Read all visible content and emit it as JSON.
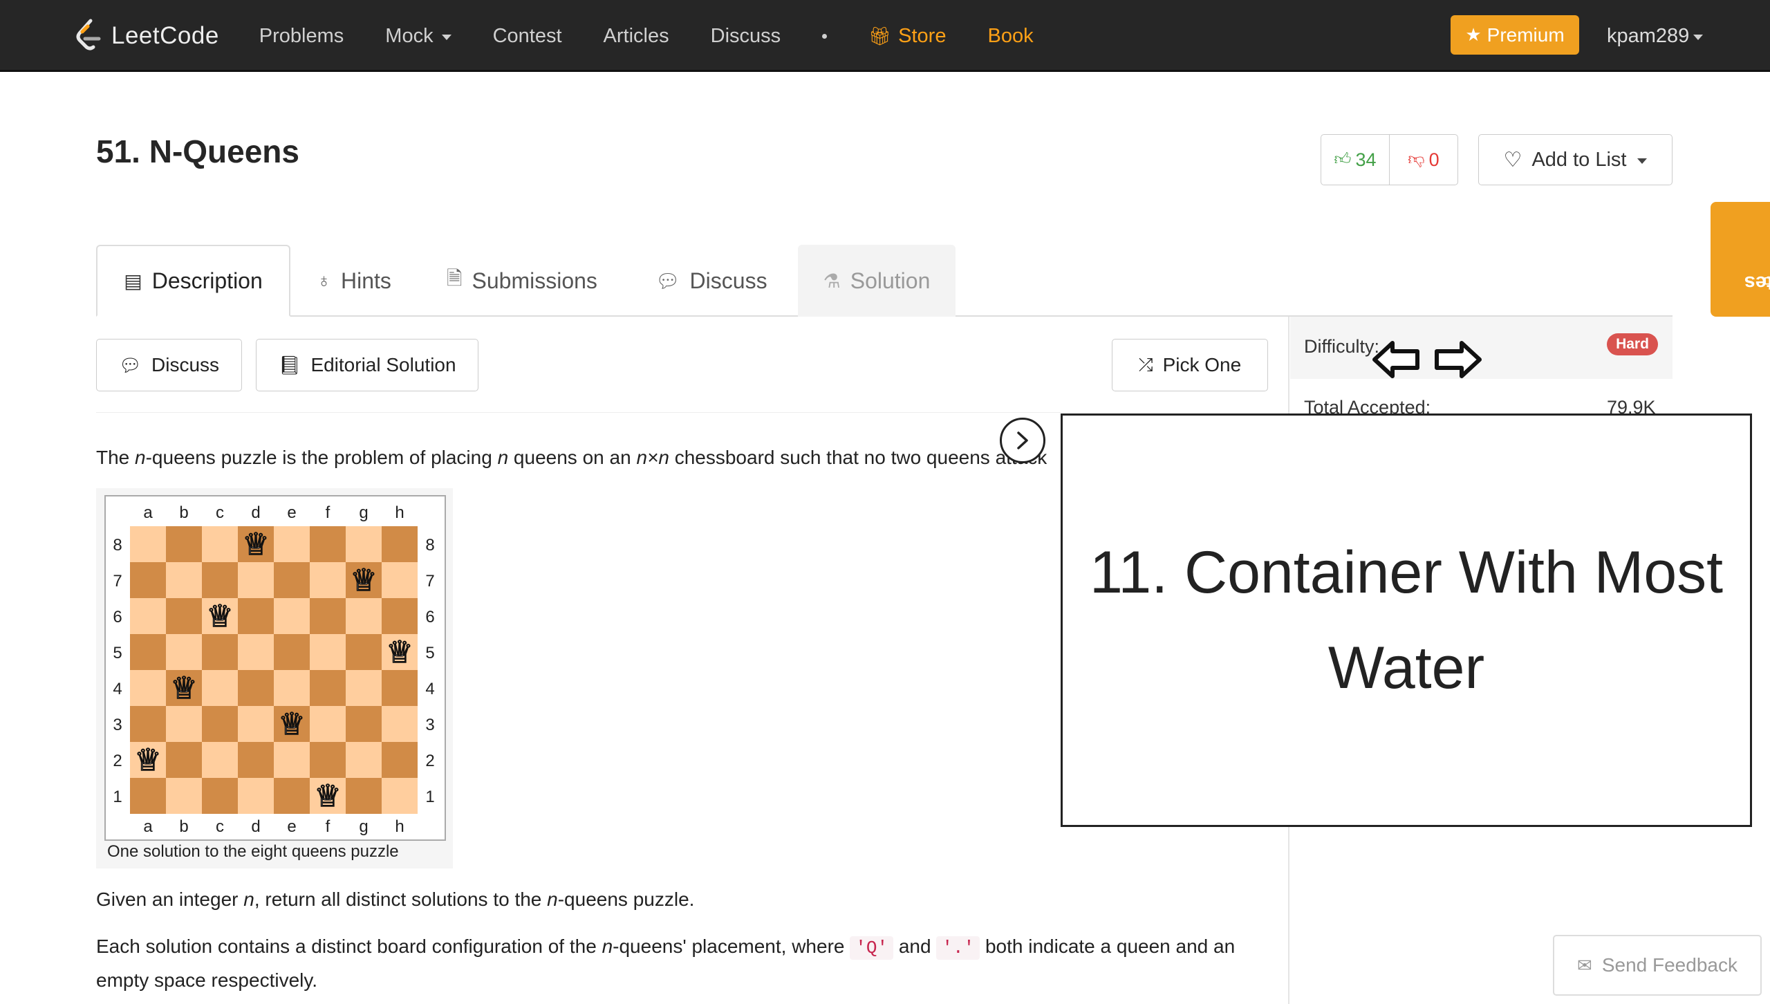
{
  "nav": {
    "logo_text": "LeetCode",
    "items": [
      {
        "label": "Problems"
      },
      {
        "label": "Mock"
      },
      {
        "label": "Contest"
      },
      {
        "label": "Articles"
      },
      {
        "label": "Discuss"
      }
    ],
    "store_label": "Store",
    "book_label": "Book",
    "premium_label": "Premium",
    "username": "kpam289",
    "accent_color": "#ffa116"
  },
  "problem": {
    "title": "51. N-Queens",
    "likes": "34",
    "dislikes": "0",
    "add_to_list_label": "Add to List"
  },
  "notes_label": "Notes",
  "tabs": [
    {
      "label": "Description",
      "icon": "description-icon"
    },
    {
      "label": "Hints",
      "icon": "bulb-icon"
    },
    {
      "label": "Submissions",
      "icon": "code-file-icon"
    },
    {
      "label": "Discuss",
      "icon": "comments-icon"
    },
    {
      "label": "Solution",
      "icon": "flask-icon"
    }
  ],
  "actions": {
    "discuss_label": "Discuss",
    "editorial_label": "Editorial Solution",
    "pick_one_label": "Pick One"
  },
  "side": {
    "difficulty_label": "Difficulty:",
    "difficulty_value": "Hard",
    "accepted_label": "Total Accepted:",
    "accepted_value": "79.9K"
  },
  "content": {
    "intro_a": "The ",
    "intro_n1": "n",
    "intro_b": "-queens puzzle is the problem of placing ",
    "intro_n2": "n",
    "intro_c": " queens on an ",
    "intro_nxn": "n×n",
    "intro_d": " chessboard such that no two queens attack",
    "given_a": "Given an integer ",
    "given_n1": "n",
    "given_b": ", return all distinct solutions to the ",
    "given_n2": "n",
    "given_c": "-queens puzzle.",
    "each_a": "Each solution contains a distinct board configuration of the ",
    "each_n": "n",
    "each_b": "-queens' placement, where ",
    "code_q": "'Q'",
    "each_and": " and ",
    "code_dot": "'.'",
    "each_c": " both indicate a queen and an",
    "each_line2": "empty space respectively.",
    "board_caption": "One solution to the eight queens puzzle",
    "board_files": [
      "a",
      "b",
      "c",
      "d",
      "e",
      "f",
      "g",
      "h"
    ],
    "board_ranks": [
      "8",
      "7",
      "6",
      "5",
      "4",
      "3",
      "2",
      "1"
    ],
    "queens": [
      "d8",
      "g7",
      "c6",
      "h5",
      "b4",
      "e3",
      "a2",
      "f1"
    ]
  },
  "overlay": {
    "title": "11. Container With Most Water"
  },
  "feedback_label": "Send Feedback"
}
